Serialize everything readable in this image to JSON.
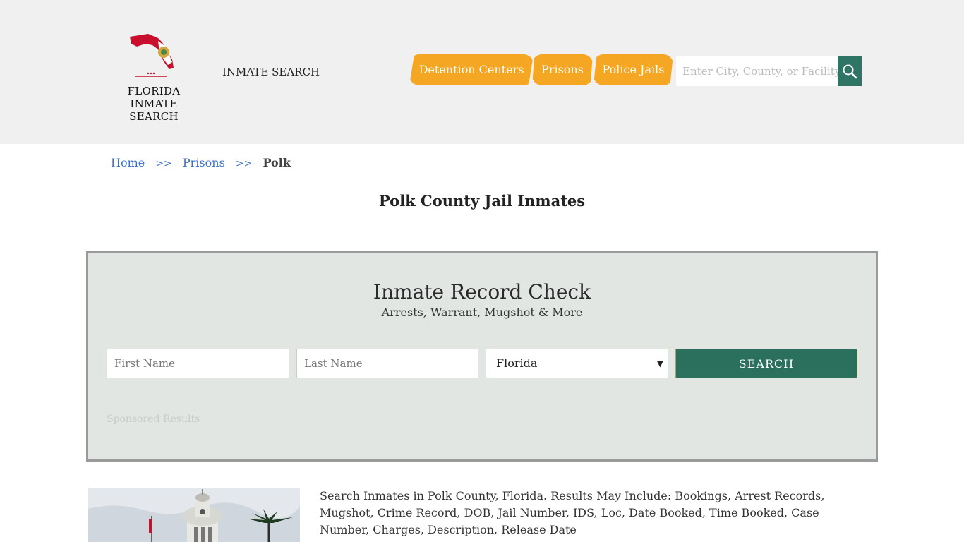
{
  "header": {
    "logo_line1": "FLORIDA",
    "logo_line2": "INMATE SEARCH",
    "site_name": "INMATE SEARCH",
    "nav": {
      "detention": "Detention Centers",
      "prisons": "Prisons",
      "police": "Police Jails"
    },
    "search_placeholder": "Enter City, County, or Facility",
    "search_icon": "magnifier-icon"
  },
  "breadcrumb": {
    "home": "Home",
    "sep": ">>",
    "prisons": "Prisons",
    "current": "Polk"
  },
  "page_title": "Polk County Jail Inmates",
  "record_check": {
    "title": "Inmate Record Check",
    "subtitle": "Arrests, Warrant, Mugshot & More",
    "first_placeholder": "First Name",
    "last_placeholder": "Last Name",
    "state_value": "Florida",
    "search_label": "SEARCH",
    "sponsored": "Sponsored Results"
  },
  "description": "Search Inmates in Polk County, Florida. Results May Include: Bookings, Arrest Records, Mugshot, Crime Record, DOB, Jail Number, IDS, Loc, Date Booked, Time Booked, Case Number, Charges, Description, Release Date",
  "colors": {
    "nav_orange": "#f5a623",
    "search_green": "#2a705d",
    "link_blue": "#3b6fc7"
  }
}
